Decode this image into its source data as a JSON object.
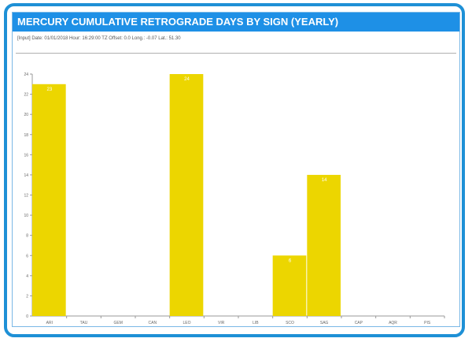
{
  "panel": {
    "title": "MERCURY CUMULATIVE RETROGRADE DAYS BY SIGN (YEARLY)",
    "input_line": "[Input] Date: 01/01/2018 Hour: 16:29:00 TZ Offset: 0.0 Long.: -0.07 Lat.: 51.30"
  },
  "colors": {
    "frame": "#1e90d6",
    "title_bar": "#1e90e6",
    "bar": "#ecd600"
  },
  "chart_data": {
    "type": "bar",
    "categories": [
      "ARI",
      "TAU",
      "GEM",
      "CAN",
      "LEO",
      "VIR",
      "LIB",
      "SCO",
      "SAG",
      "CAP",
      "AQR",
      "PIS"
    ],
    "values": [
      23,
      0,
      0,
      0,
      24,
      0,
      0,
      6,
      14,
      0,
      0,
      0
    ],
    "data_labels": [
      "23",
      "",
      "",
      "",
      "24",
      "",
      "",
      "6",
      "14",
      "",
      "",
      ""
    ],
    "yticks": [
      0,
      2,
      4,
      6,
      8,
      10,
      12,
      14,
      16,
      18,
      20,
      22,
      24
    ],
    "ylim": [
      0,
      24
    ],
    "title": "",
    "xlabel": "",
    "ylabel": "",
    "grid": false,
    "legend": "none"
  }
}
